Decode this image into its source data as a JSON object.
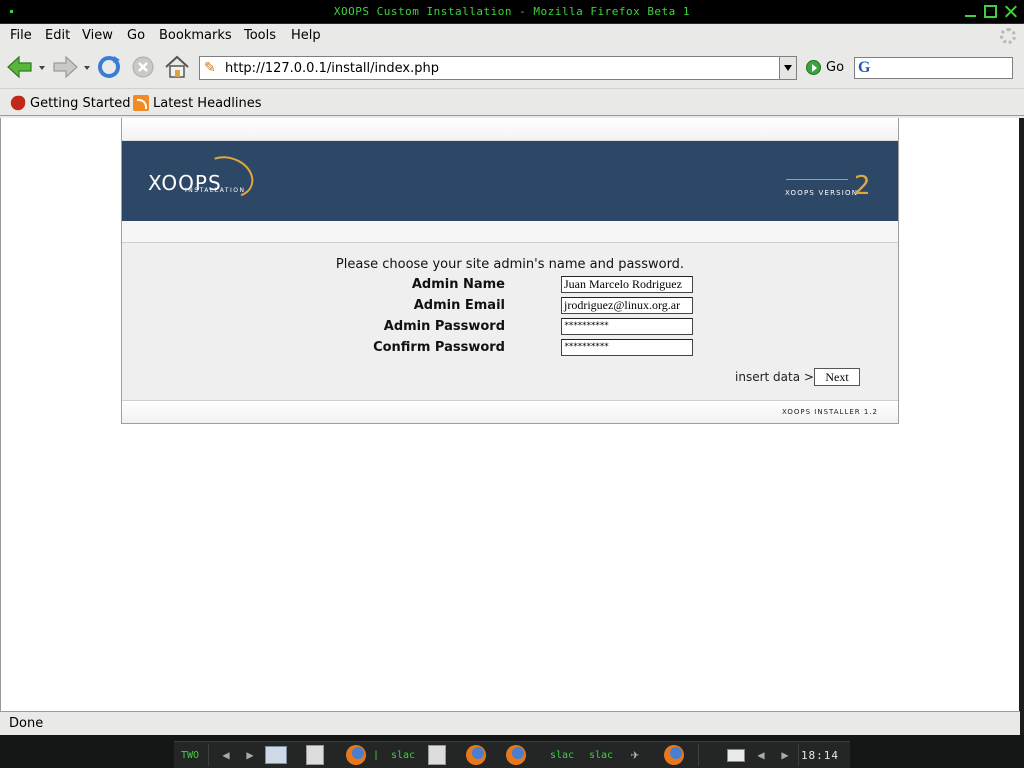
{
  "window": {
    "title": "XOOPS Custom Installation - Mozilla Firefox Beta 1"
  },
  "menubar": {
    "items": [
      {
        "label": "File"
      },
      {
        "label": "Edit"
      },
      {
        "label": "View"
      },
      {
        "label": "Go"
      },
      {
        "label": "Bookmarks"
      },
      {
        "label": "Tools"
      },
      {
        "label": "Help"
      }
    ]
  },
  "navbar": {
    "url": "http://127.0.0.1/install/index.php",
    "go_label": "Go",
    "search_value": ""
  },
  "bookmarks": [
    {
      "label": "Getting Started"
    },
    {
      "label": "Latest Headlines"
    }
  ],
  "installer": {
    "logo_text": "XOOPS",
    "logo_subtext": "INSTALLATION",
    "version_text": "XOOPS VERSION",
    "version_number": "2",
    "prompt": "Please choose your site admin's name and password.",
    "fields": [
      {
        "label": "Admin Name",
        "value": "Juan Marcelo Rodriguez",
        "type": "text"
      },
      {
        "label": "Admin Email",
        "value": "jrodriguez@linux.org.ar",
        "type": "text"
      },
      {
        "label": "Admin Password",
        "value": "**********",
        "type": "password"
      },
      {
        "label": "Confirm Password",
        "value": "**********",
        "type": "password"
      }
    ],
    "insert_label": "insert data >>",
    "next_label": "Next",
    "footer": "XOOPS INSTALLER 1.2"
  },
  "status": {
    "text": "Done"
  },
  "taskbar": {
    "workspace": "TWO",
    "items": [
      "slac",
      "slac",
      "slac"
    ],
    "clock": "18:14"
  },
  "colors": {
    "titlebar_text": "#3fd23f",
    "banner": "#2d4867",
    "accent": "#e0a73a"
  }
}
